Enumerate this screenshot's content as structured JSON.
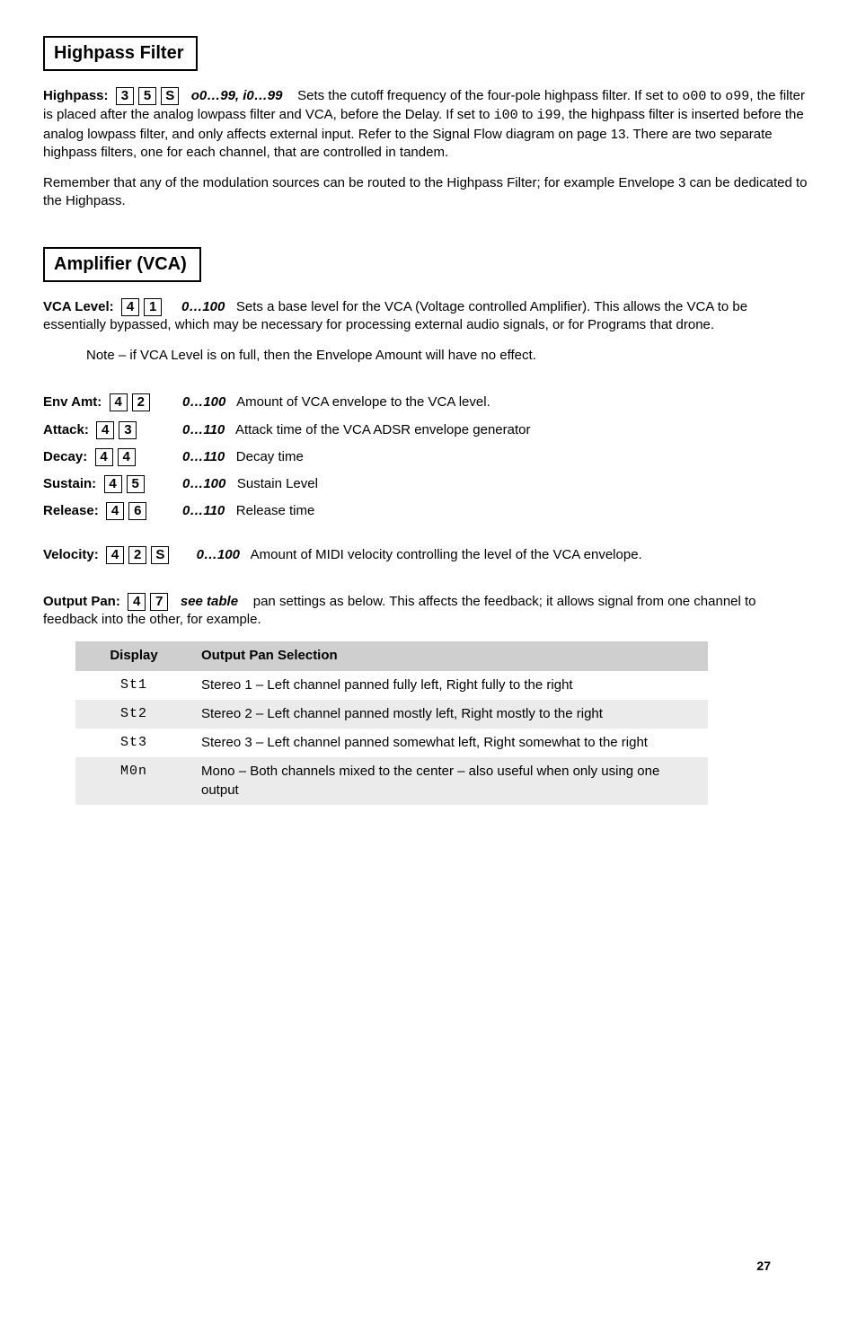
{
  "sections": {
    "highpass": {
      "title": "Highpass Filter",
      "param": {
        "label": "Highpass:",
        "keys": [
          "3",
          "5",
          "S"
        ],
        "range": "o0…99, i0…99",
        "lead": "Sets the cutoff frequency of the four-pole highpass filter. If set to ",
        "code1": "o00",
        "mid1": " to ",
        "code2": "o99",
        "mid2": ", the filter is placed after the analog lowpass filter and VCA, before the Delay. If set to ",
        "code3": "i00",
        "mid3": " to ",
        "code4": "i99",
        "tail": ", the highpass filter is inserted before the analog lowpass filter, and only affects external input. Refer to the Signal Flow diagram on page 13. There are two separate highpass filters, one for each channel, that are controlled in tandem."
      },
      "note": "Remember that any of the modulation sources can be routed to the Highpass Filter; for example Envelope 3 can be dedicated to the Highpass."
    },
    "amp": {
      "title": "Amplifier (VCA)",
      "vca": {
        "label": "VCA Level:",
        "keys": [
          "4",
          "1"
        ],
        "range": "0…100",
        "desc": "Sets a base level for the VCA (Voltage controlled Amplifier). This allows the VCA to be essentially bypassed, which may be necessary for processing external audio signals, or for Programs that drone."
      },
      "vca_note": "Note – if VCA Level is on full, then the Envelope Amount will have no effect.",
      "rows": [
        {
          "label": "Env Amt:",
          "keys": [
            "4",
            "2"
          ],
          "range": "0…100",
          "desc": "Amount of VCA envelope to the VCA level."
        },
        {
          "label": "Attack:",
          "keys": [
            "4",
            "3"
          ],
          "range": "0…110",
          "desc": "Attack time of the VCA ADSR envelope generator"
        },
        {
          "label": "Decay:",
          "keys": [
            "4",
            "4"
          ],
          "range": "0…110",
          "desc": "Decay time"
        },
        {
          "label": "Sustain:",
          "keys": [
            "4",
            "5"
          ],
          "range": "0…100",
          "desc": "Sustain Level"
        },
        {
          "label": "Release:",
          "keys": [
            "4",
            "6"
          ],
          "range": "0…110",
          "desc": "Release time"
        }
      ],
      "velocity": {
        "label": "Velocity:",
        "keys": [
          "4",
          "2",
          "S"
        ],
        "range": "0…100",
        "desc": "Amount of MIDI velocity controlling the level of the VCA envelope."
      },
      "pan": {
        "label": "Output Pan:",
        "keys": [
          "4",
          "7"
        ],
        "range": "see table",
        "desc": "pan settings as below. This affects the feedback; it allows signal from one channel to feedback into the other, for example."
      },
      "pan_table": {
        "head_display": "Display",
        "head_sel": "Output Pan Selection",
        "rows": [
          {
            "disp": "St1",
            "desc": "Stereo 1 – Left channel panned fully left, Right fully to the right"
          },
          {
            "disp": "St2",
            "desc": "Stereo 2 – Left channel panned mostly left, Right mostly to the right"
          },
          {
            "disp": "St3",
            "desc": "Stereo 3 – Left channel panned somewhat left, Right somewhat to the right"
          },
          {
            "disp": "M0n",
            "desc": "Mono – Both channels mixed to the center – also useful when only using one output"
          }
        ]
      }
    }
  },
  "page_number": "27"
}
